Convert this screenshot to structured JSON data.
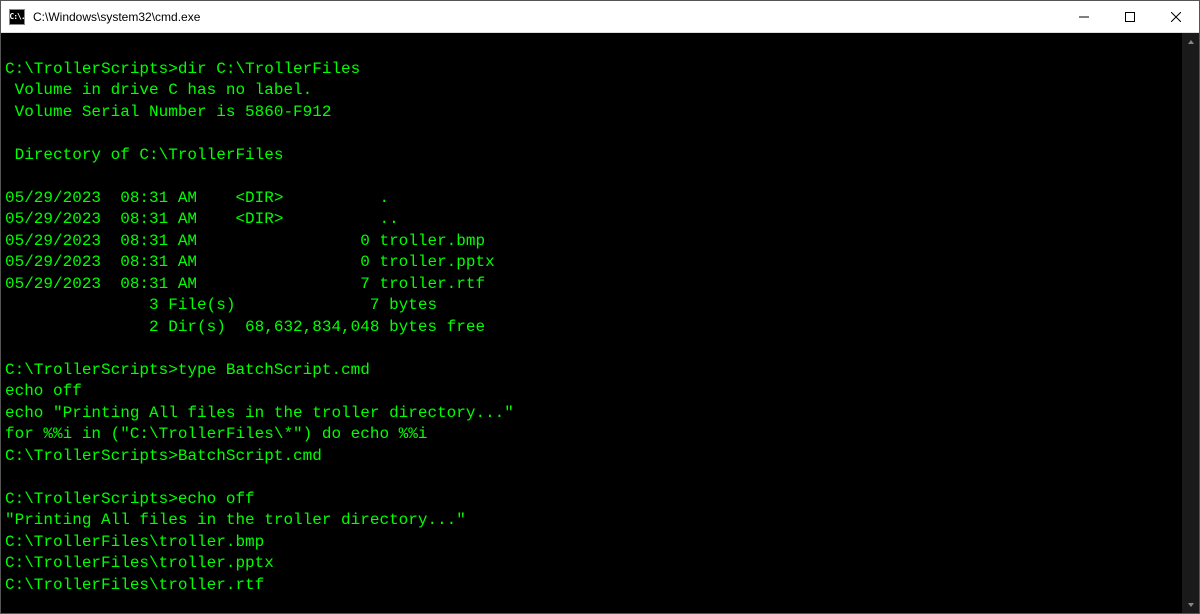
{
  "window": {
    "title": "C:\\Windows\\system32\\cmd.exe",
    "icon_label": "C:\\."
  },
  "terminal": {
    "lines": [
      "",
      "C:\\TrollerScripts>dir C:\\TrollerFiles",
      " Volume in drive C has no label.",
      " Volume Serial Number is 5860-F912",
      "",
      " Directory of C:\\TrollerFiles",
      "",
      "05/29/2023  08:31 AM    <DIR>          .",
      "05/29/2023  08:31 AM    <DIR>          ..",
      "05/29/2023  08:31 AM                 0 troller.bmp",
      "05/29/2023  08:31 AM                 0 troller.pptx",
      "05/29/2023  08:31 AM                 7 troller.rtf",
      "               3 File(s)              7 bytes",
      "               2 Dir(s)  68,632,834,048 bytes free",
      "",
      "C:\\TrollerScripts>type BatchScript.cmd",
      "echo off",
      "echo \"Printing All files in the troller directory...\"",
      "for %%i in (\"C:\\TrollerFiles\\*\") do echo %%i",
      "C:\\TrollerScripts>BatchScript.cmd",
      "",
      "C:\\TrollerScripts>echo off",
      "\"Printing All files in the troller directory...\"",
      "C:\\TrollerFiles\\troller.bmp",
      "C:\\TrollerFiles\\troller.pptx",
      "C:\\TrollerFiles\\troller.rtf"
    ]
  }
}
